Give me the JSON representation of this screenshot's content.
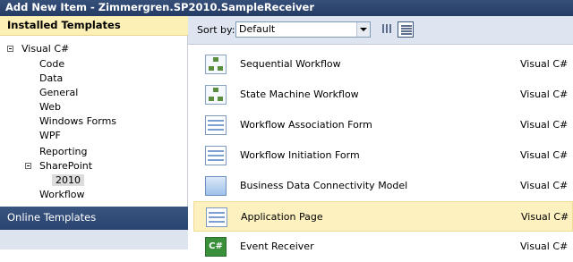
{
  "dialog": {
    "title": "Add New Item - Zimmergren.SP2010.SampleReceiver"
  },
  "left_panel": {
    "header": "Installed Templates",
    "tree": {
      "root": "Visual C#",
      "children": [
        "Code",
        "Data",
        "General",
        "Web",
        "Windows Forms",
        "WPF",
        "Reporting"
      ],
      "sharepoint": "SharePoint",
      "sharepoint_child": "2010",
      "workflow": "Workflow"
    },
    "online_templates": "Online Templates"
  },
  "toolbar": {
    "sort_label": "Sort by:",
    "sort_value": "Default",
    "views": [
      "small-icons-view",
      "details-view"
    ]
  },
  "templates": [
    {
      "name": "Sequential Workflow",
      "language": "Visual C#",
      "icon": "workflow-icon"
    },
    {
      "name": "State Machine Workflow",
      "language": "Visual C#",
      "icon": "workflow-icon"
    },
    {
      "name": "Workflow Association Form",
      "language": "Visual C#",
      "icon": "form-icon"
    },
    {
      "name": "Workflow Initiation Form",
      "language": "Visual C#",
      "icon": "form-icon"
    },
    {
      "name": "Business Data Connectivity Model",
      "language": "Visual C#",
      "icon": "bdc-model-icon"
    },
    {
      "name": "Application Page",
      "language": "Visual C#",
      "icon": "form-icon",
      "selected": true
    },
    {
      "name": "Event Receiver",
      "language": "Visual C#",
      "icon": "csharp-file-icon"
    }
  ]
}
